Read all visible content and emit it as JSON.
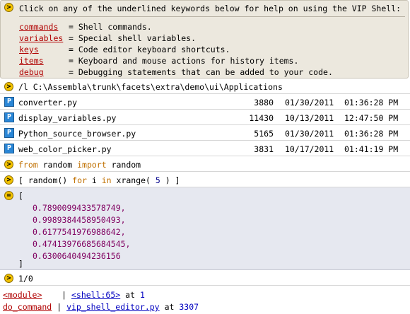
{
  "help": {
    "title": "Click on any of the underlined keywords below for help on using the VIP Shell:",
    "items": [
      {
        "keyword": "commands",
        "desc": "= Shell commands."
      },
      {
        "keyword": "variables",
        "desc": "= Special shell variables."
      },
      {
        "keyword": "keys",
        "desc": "= Code editor keyboard shortcuts."
      },
      {
        "keyword": "items",
        "desc": "= Keyboard and mouse actions for history items."
      },
      {
        "keyword": "debug",
        "desc": "= Debugging statements that can be added to your code."
      }
    ]
  },
  "command1": {
    "badge": ">",
    "text": "/l C:\\Assembla\\trunk\\facets\\extra\\demo\\ui\\Applications"
  },
  "files": [
    {
      "icon": "P",
      "name": "converter.py",
      "size": "3880",
      "date": "01/30/2011",
      "time": "01:36:28 PM"
    },
    {
      "icon": "P",
      "name": "display_variables.py",
      "size": "11430",
      "date": "10/13/2011",
      "time": "12:47:50 PM"
    },
    {
      "icon": "P",
      "name": "Python_source_browser.py",
      "size": "5165",
      "date": "01/30/2011",
      "time": "01:36:28 PM"
    },
    {
      "icon": "P",
      "name": "web_color_picker.py",
      "size": "3831",
      "date": "10/17/2011",
      "time": "01:41:19 PM"
    }
  ],
  "command2": {
    "badge": ">",
    "kw_from": "from",
    "mod": " random ",
    "kw_import": "import",
    "name": " random"
  },
  "command3": {
    "badge": ">",
    "pre": "[ random() ",
    "kw_for": "for",
    "var": " i ",
    "kw_in": "in",
    "call": " xrange( ",
    "arg": "5",
    "post": " ) ]"
  },
  "result": {
    "badge": "=",
    "open": "[",
    "values": [
      "0.7890099433578749,",
      "0.9989384458950493,",
      "0.6177541976988642,",
      "0.47413976685684545,",
      "0.6300640494236156"
    ],
    "close": "]"
  },
  "command4": {
    "badge": ">",
    "text": "1/0"
  },
  "traceback": [
    {
      "func": "<module>",
      "sep": "|",
      "file": "<shell:65>",
      "at": "at",
      "line": "1"
    },
    {
      "func": "do_command",
      "sep": "|",
      "file": "vip_shell_editor.py",
      "at": "at",
      "line": "3307"
    }
  ]
}
